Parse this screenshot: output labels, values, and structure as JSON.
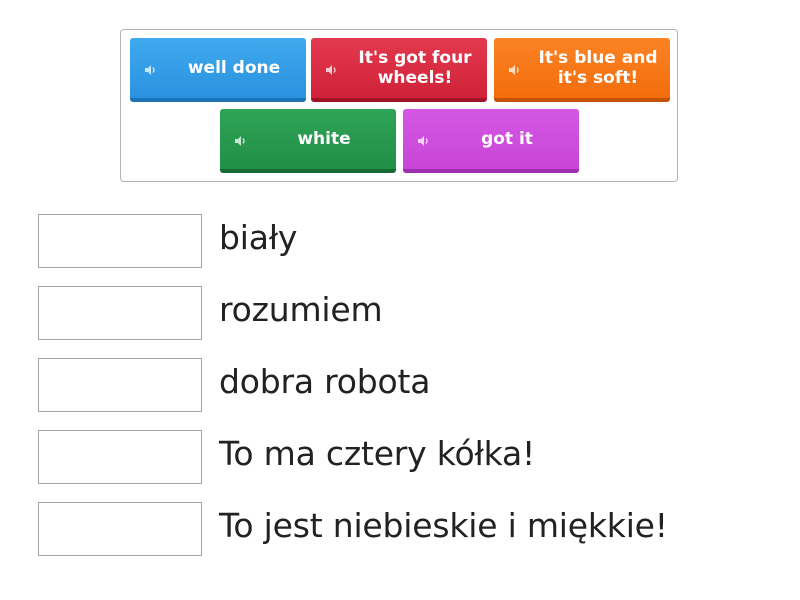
{
  "tiles": [
    {
      "label": "well done",
      "color": "blue",
      "icon": "speaker-icon"
    },
    {
      "label": "It's got four wheels!",
      "color": "red",
      "icon": "speaker-icon"
    },
    {
      "label": "It's blue and it's soft!",
      "color": "orange",
      "icon": "speaker-icon"
    },
    {
      "label": "white",
      "color": "green",
      "icon": "speaker-icon"
    },
    {
      "label": "got it",
      "color": "purple",
      "icon": "speaker-icon"
    }
  ],
  "terms": [
    {
      "text": "biały"
    },
    {
      "text": "rozumiem"
    },
    {
      "text": "dobra robota"
    },
    {
      "text": "To ma cztery kółka!"
    },
    {
      "text": "To jest niebieskie i miękkie!"
    }
  ],
  "colors": {
    "blue": "#2a92e0",
    "red": "#cf2238",
    "orange": "#f36d0c",
    "green": "#218f47",
    "purple": "#c845d8"
  }
}
